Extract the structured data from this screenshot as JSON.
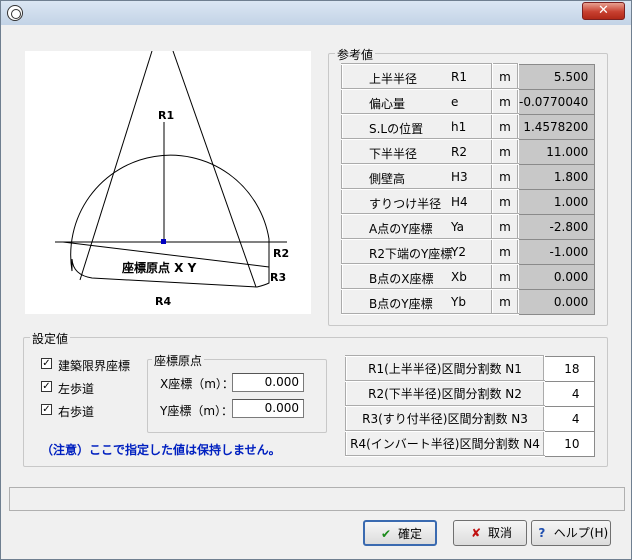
{
  "window": {
    "title": ""
  },
  "reference": {
    "group_label": "参考値",
    "rows": [
      {
        "label": "上半半径",
        "sym": "R1",
        "unit": "m",
        "value": "5.500"
      },
      {
        "label": "偏心量",
        "sym": "e",
        "unit": "m",
        "value": "-0.0770040"
      },
      {
        "label": "S.Lの位置",
        "sym": "h1",
        "unit": "m",
        "value": "1.4578200"
      },
      {
        "label": "下半半径",
        "sym": "R2",
        "unit": "m",
        "value": "11.000"
      },
      {
        "label": "側壁高",
        "sym": "H3",
        "unit": "m",
        "value": "1.800"
      },
      {
        "label": "すりつけ半径",
        "sym": "H4",
        "unit": "m",
        "value": "1.000"
      },
      {
        "label": "A点のY座標",
        "sym": "Ya",
        "unit": "m",
        "value": "-2.800"
      },
      {
        "label": "R2下端のY座標",
        "sym": "Y2",
        "unit": "m",
        "value": "-1.000"
      },
      {
        "label": "B点のX座標",
        "sym": "Xb",
        "unit": "m",
        "value": "0.000"
      },
      {
        "label": "B点のY座標",
        "sym": "Yb",
        "unit": "m",
        "value": "0.000"
      }
    ]
  },
  "diagram": {
    "r1": "R1",
    "r2": "R2",
    "r3": "R3",
    "r4": "R4",
    "origin": "座標原点 X Y"
  },
  "settings": {
    "group_label": "設定値",
    "checks": [
      {
        "label": "建築限界座標",
        "checked": true
      },
      {
        "label": "左歩道",
        "checked": true
      },
      {
        "label": "右歩道",
        "checked": true
      }
    ],
    "origin_group": "座標原点",
    "x_label": "X座標（m）：",
    "x_value": "0.000",
    "y_label": "Y座標（m）：",
    "y_value": "0.000",
    "note": "（注意）ここで指定した値は保持しません。",
    "divisions": [
      {
        "label": "R1(上半半径)区間分割数 N1",
        "value": "18"
      },
      {
        "label": "R2(下半半径)区間分割数 N2",
        "value": "4"
      },
      {
        "label": "R3(すり付半径)区間分割数 N3",
        "value": "4"
      },
      {
        "label": "R4(インバート半径)区間分割数 N4",
        "value": "10"
      }
    ]
  },
  "buttons": {
    "ok": "確定",
    "cancel": "取消",
    "help": "ヘルプ(H)"
  },
  "colors": {
    "ok_icon": "#1a8a1a",
    "cancel_icon": "#c01010",
    "help_icon": "#2050b0"
  }
}
